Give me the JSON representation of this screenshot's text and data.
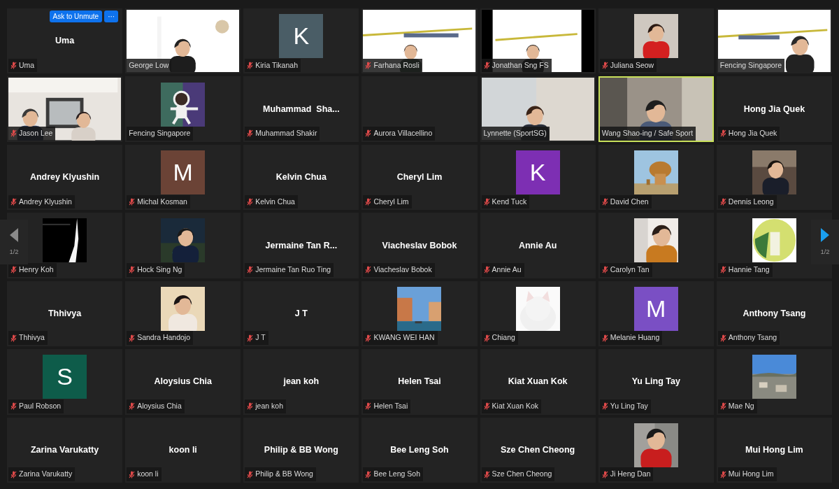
{
  "tiles": [
    {
      "name": "Uma",
      "muted": true,
      "speaking": false,
      "kind": "name",
      "title": "Uma",
      "hover_buttons": [
        "Ask to Unmute",
        "···"
      ]
    },
    {
      "name": "George Low",
      "muted": false,
      "speaking": false,
      "kind": "video"
    },
    {
      "name": "Kiria Tikanah",
      "muted": true,
      "speaking": false,
      "kind": "initial",
      "initial": "K",
      "color": "#4a5d66"
    },
    {
      "name": "Farhana Rosli",
      "muted": true,
      "speaking": false,
      "kind": "video"
    },
    {
      "name": "Jonathan Sng FS",
      "muted": true,
      "speaking": false,
      "kind": "video"
    },
    {
      "name": "Juliana Seow",
      "muted": true,
      "speaking": false,
      "kind": "picture"
    },
    {
      "name": "Fencing Singapore",
      "muted": false,
      "speaking": false,
      "kind": "video"
    },
    {
      "name": "Jason Lee",
      "muted": true,
      "speaking": false,
      "kind": "video"
    },
    {
      "name": "Fencing Singapore",
      "muted": false,
      "speaking": false,
      "kind": "picture"
    },
    {
      "name": "Muhammad Shakir",
      "muted": true,
      "speaking": false,
      "kind": "name",
      "title": "Muhammad  Sha..."
    },
    {
      "name": "Aurora Villacellino",
      "muted": true,
      "speaking": false,
      "kind": "blank"
    },
    {
      "name": "Lynnette (SportSG)",
      "muted": false,
      "speaking": false,
      "kind": "video"
    },
    {
      "name": "Wang Shao-ing / Safe Sport",
      "muted": false,
      "speaking": true,
      "kind": "video"
    },
    {
      "name": "Hong Jia Quek",
      "muted": true,
      "speaking": false,
      "kind": "name",
      "title": "Hong Jia Quek"
    },
    {
      "name": "Andrey Klyushin",
      "muted": true,
      "speaking": false,
      "kind": "name",
      "title": "Andrey Klyushin"
    },
    {
      "name": "Michal Kosman",
      "muted": true,
      "speaking": false,
      "kind": "initial",
      "initial": "M",
      "color": "#6b4336"
    },
    {
      "name": "Kelvin Chua",
      "muted": true,
      "speaking": false,
      "kind": "name",
      "title": "Kelvin Chua"
    },
    {
      "name": "Cheryl Lim",
      "muted": true,
      "speaking": false,
      "kind": "name",
      "title": "Cheryl Lim"
    },
    {
      "name": "Kend Tuck",
      "muted": true,
      "speaking": false,
      "kind": "initial",
      "initial": "K",
      "color": "#7d2fb3"
    },
    {
      "name": "David Chen",
      "muted": true,
      "speaking": false,
      "kind": "picture"
    },
    {
      "name": "Dennis Leong",
      "muted": true,
      "speaking": false,
      "kind": "picture"
    },
    {
      "name": "Henry Koh",
      "muted": true,
      "speaking": false,
      "kind": "picture"
    },
    {
      "name": "Hock Sing Ng",
      "muted": true,
      "speaking": false,
      "kind": "picture"
    },
    {
      "name": "Jermaine Tan Ruo Ting",
      "muted": true,
      "speaking": false,
      "kind": "name",
      "title": "Jermaine Tan R..."
    },
    {
      "name": "Viacheslav Bobok",
      "muted": true,
      "speaking": false,
      "kind": "name",
      "title": "Viacheslav Bobok"
    },
    {
      "name": "Annie Au",
      "muted": true,
      "speaking": false,
      "kind": "name",
      "title": "Annie Au"
    },
    {
      "name": "Carolyn Tan",
      "muted": true,
      "speaking": false,
      "kind": "picture"
    },
    {
      "name": "Hannie Tang",
      "muted": true,
      "speaking": false,
      "kind": "picture"
    },
    {
      "name": "Thhivya",
      "muted": true,
      "speaking": false,
      "kind": "name",
      "title": "Thhivya"
    },
    {
      "name": "Sandra Handojo",
      "muted": true,
      "speaking": false,
      "kind": "picture"
    },
    {
      "name": "J T",
      "muted": true,
      "speaking": false,
      "kind": "name",
      "title": "J T"
    },
    {
      "name": "KWANG WEI HAN",
      "muted": true,
      "speaking": false,
      "kind": "picture"
    },
    {
      "name": "Chiang",
      "muted": true,
      "speaking": false,
      "kind": "picture"
    },
    {
      "name": "Melanie Huang",
      "muted": true,
      "speaking": false,
      "kind": "initial",
      "initial": "M",
      "color": "#7a4fc4"
    },
    {
      "name": "Anthony Tsang",
      "muted": true,
      "speaking": false,
      "kind": "name",
      "title": "Anthony Tsang"
    },
    {
      "name": "Paul Robson",
      "muted": true,
      "speaking": false,
      "kind": "initial",
      "initial": "S",
      "color": "#0e5c4a"
    },
    {
      "name": "Aloysius Chia",
      "muted": true,
      "speaking": false,
      "kind": "name",
      "title": "Aloysius Chia"
    },
    {
      "name": "jean koh",
      "muted": true,
      "speaking": false,
      "kind": "name",
      "title": "jean koh"
    },
    {
      "name": "Helen Tsai",
      "muted": true,
      "speaking": false,
      "kind": "name",
      "title": "Helen Tsai"
    },
    {
      "name": "Kiat Xuan Kok",
      "muted": true,
      "speaking": false,
      "kind": "name",
      "title": "Kiat Xuan Kok"
    },
    {
      "name": "Yu Ling Tay",
      "muted": true,
      "speaking": false,
      "kind": "name",
      "title": "Yu Ling Tay"
    },
    {
      "name": "Mae Ng",
      "muted": true,
      "speaking": false,
      "kind": "picture"
    },
    {
      "name": "Zarina Varukatty",
      "muted": true,
      "speaking": false,
      "kind": "name",
      "title": "Zarina Varukatty"
    },
    {
      "name": "koon li",
      "muted": true,
      "speaking": false,
      "kind": "name",
      "title": "koon li"
    },
    {
      "name": "Philip & BB Wong",
      "muted": true,
      "speaking": false,
      "kind": "name",
      "title": "Philip & BB Wong"
    },
    {
      "name": "Bee Leng Soh",
      "muted": true,
      "speaking": false,
      "kind": "name",
      "title": "Bee Leng Soh"
    },
    {
      "name": "Sze Chen Cheong",
      "muted": true,
      "speaking": false,
      "kind": "name",
      "title": "Sze Chen Cheong"
    },
    {
      "name": "Ji Heng Dan",
      "muted": true,
      "speaking": false,
      "kind": "picture"
    },
    {
      "name": "Mui Hong Lim",
      "muted": true,
      "speaking": false,
      "kind": "name",
      "title": "Mui Hong Lim"
    }
  ],
  "pager": [
    {
      "kind": "previous",
      "page": "1/2",
      "disabled": true
    },
    {
      "kind": "next",
      "page": "1/2",
      "disabled": false
    }
  ]
}
